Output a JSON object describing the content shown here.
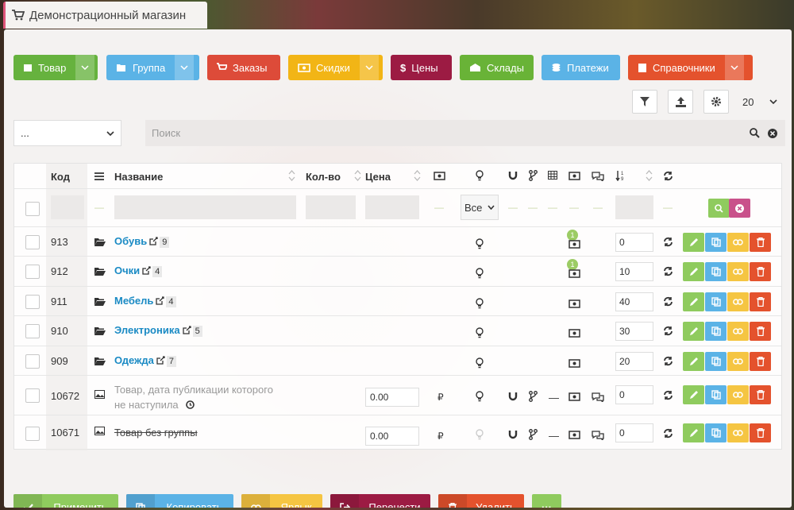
{
  "app": {
    "title": "Демонстрационный магазин"
  },
  "toolbar": {
    "product": "Товар",
    "group": "Группа",
    "orders": "Заказы",
    "discounts": "Скидки",
    "prices": "Цены",
    "warehouses": "Склады",
    "payments": "Платежи",
    "references": "Справочники"
  },
  "perpage": "20",
  "category_select": "...",
  "search": {
    "placeholder": "Поиск"
  },
  "columns": {
    "code": "Код",
    "name": "Название",
    "qty": "Кол-во",
    "price": "Цена"
  },
  "filter": {
    "visibility": "Все"
  },
  "rows": [
    {
      "code": "913",
      "name": "Обувь",
      "count": "9",
      "sort": "0",
      "badge": "1"
    },
    {
      "code": "912",
      "name": "Очки",
      "count": "4",
      "sort": "10",
      "badge": "1"
    },
    {
      "code": "911",
      "name": "Мебель",
      "count": "4",
      "sort": "40"
    },
    {
      "code": "910",
      "name": "Электроника",
      "count": "5",
      "sort": "30"
    },
    {
      "code": "909",
      "name": "Одежда",
      "count": "7",
      "sort": "20"
    },
    {
      "code": "10672",
      "name_line1": "Товар, дата публикации которого",
      "name_line2": "не наступила",
      "price": "0.00",
      "currency": "₽",
      "dash": "—",
      "sort": "0"
    },
    {
      "code": "10671",
      "name": "Товар без группы",
      "price": "0.00",
      "currency": "₽",
      "dash": "—",
      "sort": "0"
    }
  ],
  "bottom": {
    "apply": "Применить",
    "copy": "Копировать",
    "shortcut": "Ярлык",
    "move": "Перенести",
    "delete": "Удалить",
    "more": "···"
  },
  "colors": {
    "green": "#66b23e",
    "blue": "#5bb3e6",
    "red": "#dd4b39",
    "yellow": "#f2b516",
    "maroon": "#9c1b43"
  }
}
